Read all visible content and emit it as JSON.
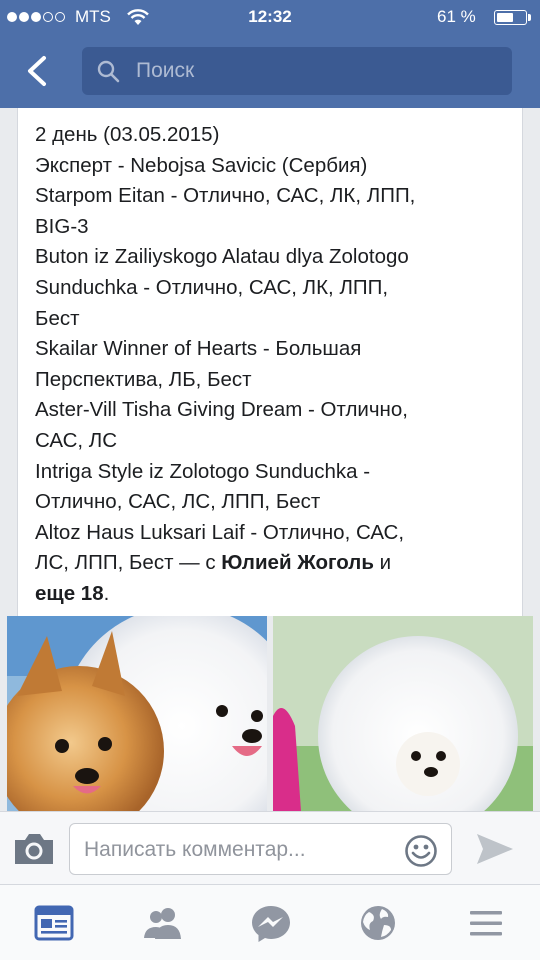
{
  "status_bar": {
    "carrier": "MTS",
    "time": "12:32",
    "battery_text": "61 %",
    "battery_level": 0.61,
    "signal_bars_on": 3,
    "signal_bars_total": 5
  },
  "nav": {
    "search_placeholder": "Поиск"
  },
  "post": {
    "lines": [
      "2 день (03.05.2015)",
      "Эксперт - Nebojsa Savicic (Сербия)",
      "Starpom Eitan - Отлично, САС, ЛК, ЛПП,",
      "BIG-3",
      "Buton iz Zailiyskogo Alatau dlya Zolotogo",
      "Sunduchka - Отлично, САС, ЛК, ЛПП,",
      "Бест",
      "Skailar Winner of Hearts - Большая",
      "Перспектива, ЛБ, Бест",
      "Aster-Vill Tisha Giving Dream - Отлично,",
      "САС, ЛС",
      "Intriga Style iz Zolotogo Sunduchka -",
      "Отлично, САС, ЛС, ЛПП, Бест",
      "Altoz Haus Luksari Laif - Отлично, САС,"
    ],
    "tag_line_prefix": "ЛС, ЛПП, Бест — с ",
    "tagged_person": "Юлией Жоголь",
    "tag_line_and": " и",
    "others": "еще 18",
    "others_suffix": "."
  },
  "comment": {
    "placeholder": "Написать комментар..."
  },
  "tabs": [
    {
      "icon": "news-feed-icon",
      "active": true
    },
    {
      "icon": "friends-icon",
      "active": false
    },
    {
      "icon": "messenger-icon",
      "active": false
    },
    {
      "icon": "globe-icon",
      "active": false
    },
    {
      "icon": "menu-icon",
      "active": false
    }
  ],
  "colors": {
    "header": "#4d6fa9",
    "search_field": "#3b5a92",
    "active_tab": "#4267b2",
    "inactive_tab": "#9197a3"
  }
}
